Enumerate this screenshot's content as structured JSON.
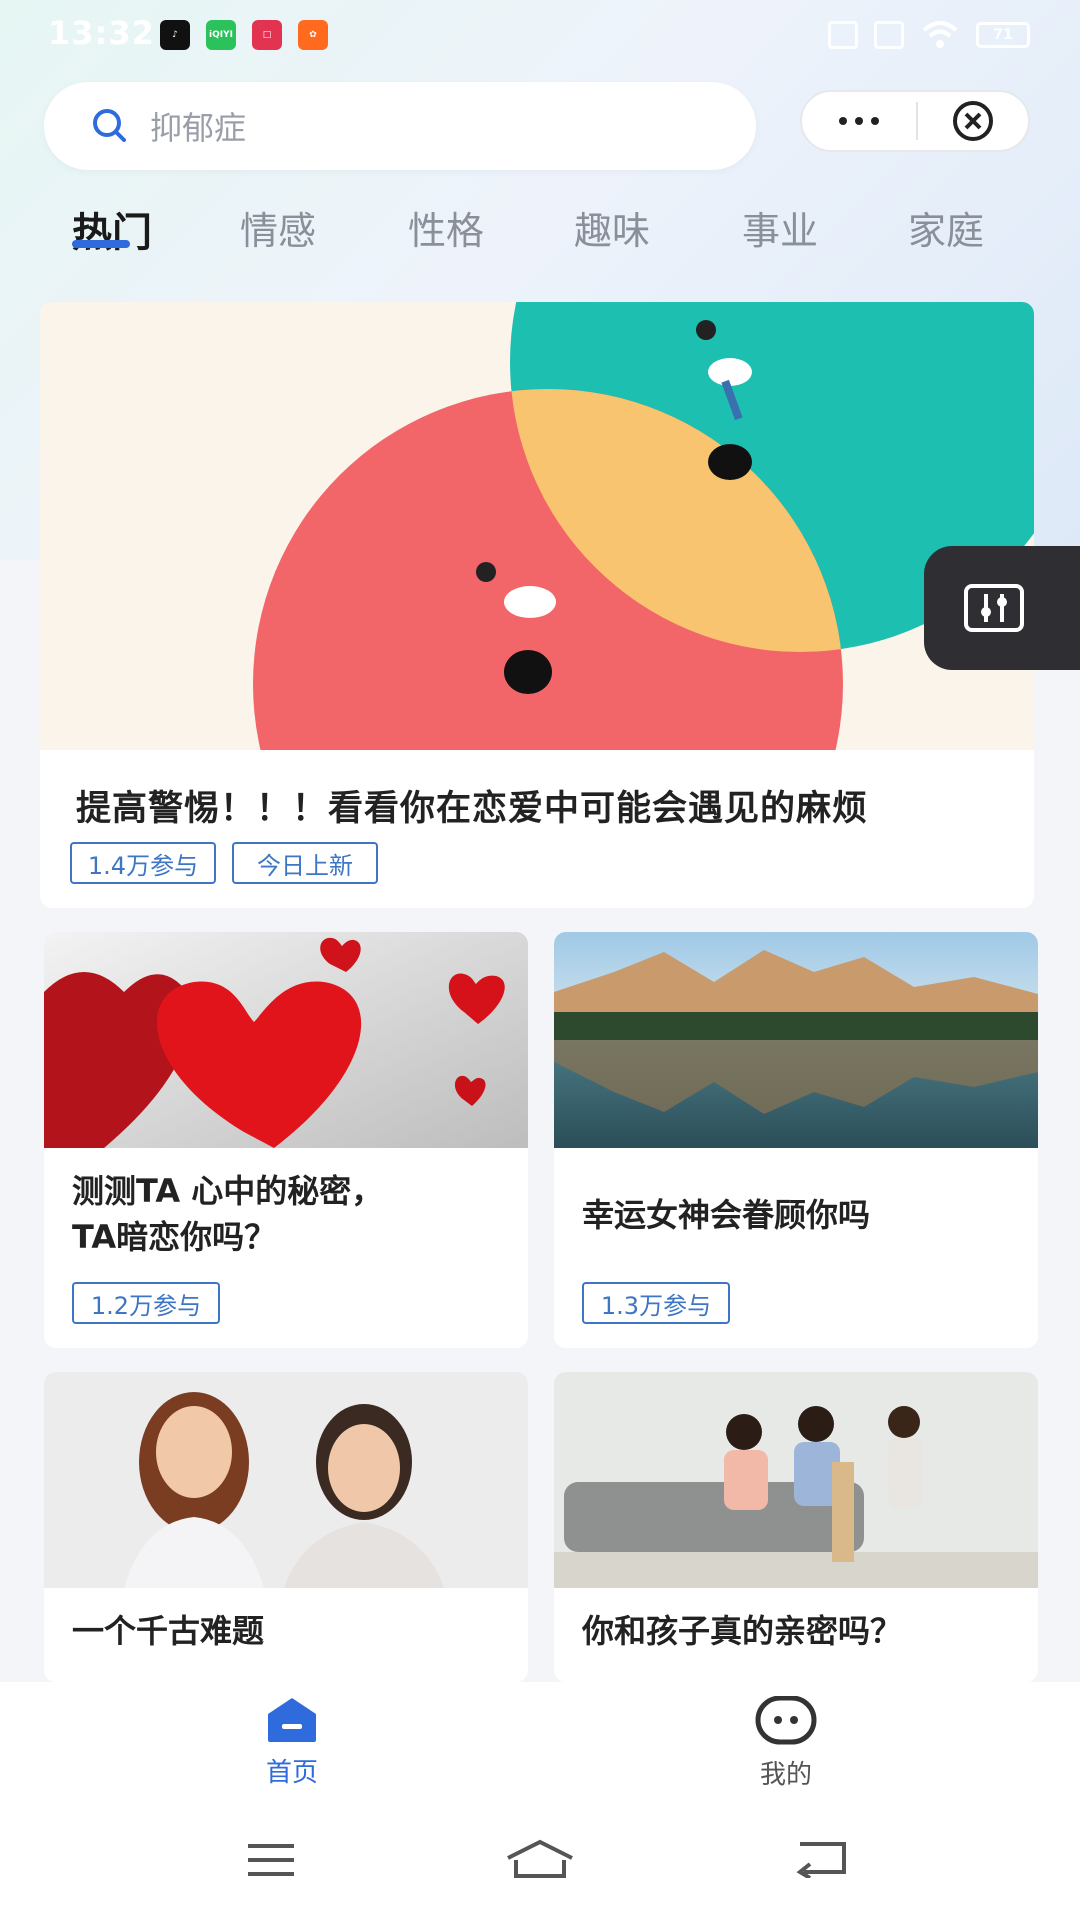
{
  "status_bar": {
    "time": "13:32",
    "apps": [
      {
        "icon": "tiktok-icon",
        "color": "#111111",
        "label": "♪"
      },
      {
        "icon": "iqiyi-icon",
        "color": "#2bc15b",
        "label": "iQIYI"
      },
      {
        "icon": "app-red-icon",
        "color": "#e23451",
        "label": "□"
      },
      {
        "icon": "kuaishou-icon",
        "color": "#ff6a1e",
        "label": "✿"
      }
    ],
    "battery": "71"
  },
  "search": {
    "placeholder": "抑郁症"
  },
  "tabs": [
    {
      "label": "热门",
      "active": true
    },
    {
      "label": "情感"
    },
    {
      "label": "性格"
    },
    {
      "label": "趣味"
    },
    {
      "label": "事业"
    },
    {
      "label": "家庭"
    }
  ],
  "feature": {
    "title": "提高警惕！！！看看你在恋爱中可能会遇见的麻烦",
    "tags": [
      "1.4万参与",
      "今日上新"
    ]
  },
  "cards": [
    {
      "title_line1": "测测TA 心中的秘密，",
      "title_line2": "TA暗恋你吗？",
      "tag": "1.2万参与"
    },
    {
      "title_line1": "幸运女神会眷顾你吗",
      "tag": "1.3万参与"
    },
    {
      "title_line1": "一个千古难题"
    },
    {
      "title_line1": "你和孩子真的亲密吗？"
    }
  ],
  "bottom_nav": [
    {
      "label": "首页",
      "icon": "home-icon",
      "active": true
    },
    {
      "label": "我的",
      "icon": "profile-icon",
      "active": false
    }
  ],
  "colors": {
    "accent": "#2f6bdc",
    "tag": "#3d76c5",
    "teal": "#1cbfb0",
    "coral": "#f26669",
    "yellow": "#f9c46f"
  }
}
